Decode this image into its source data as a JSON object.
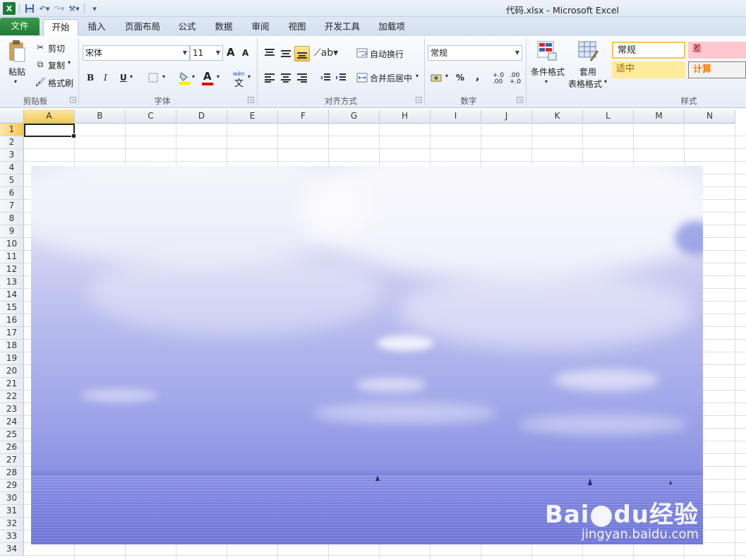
{
  "window": {
    "title": "代码.xlsx  -  Microsoft Excel"
  },
  "tabs": [
    {
      "label": "文件",
      "active": false,
      "file": true
    },
    {
      "label": "开始",
      "active": true
    },
    {
      "label": "插入"
    },
    {
      "label": "页面布局"
    },
    {
      "label": "公式"
    },
    {
      "label": "数据"
    },
    {
      "label": "审阅"
    },
    {
      "label": "视图"
    },
    {
      "label": "开发工具"
    },
    {
      "label": "加载项"
    }
  ],
  "clipboard": {
    "paste": "粘贴",
    "cut": "剪切",
    "copy": "复制",
    "format_painter": "格式刷",
    "group": "剪贴板"
  },
  "font": {
    "name": "宋体",
    "size": "11",
    "group": "字体",
    "bold": "B",
    "italic": "I",
    "underline": "U",
    "grow": "A",
    "shrink": "A",
    "font_color": "A",
    "phonetic": "wén",
    "phonetic_char": "文"
  },
  "alignment": {
    "wrap": "自动换行",
    "merge": "合并后居中",
    "group": "对齐方式"
  },
  "number": {
    "format": "常规",
    "percent": "%",
    "comma": ",",
    "inc": "+.0 .00",
    "dec": ".00 +.0",
    "group": "数字"
  },
  "styles": {
    "conditional": "条件格式",
    "table_line1": "套用",
    "table_line2": "表格格式",
    "normal": "常规",
    "bad": "差",
    "neutral": "适中",
    "calc": "计算",
    "group": "样式"
  },
  "columns": [
    "A",
    "B",
    "C",
    "D",
    "E",
    "F",
    "G",
    "H",
    "I",
    "J",
    "K",
    "L",
    "M",
    "N"
  ],
  "rows": [
    "1",
    "2",
    "3",
    "4",
    "5",
    "6",
    "7",
    "8",
    "9",
    "10",
    "11",
    "12",
    "13",
    "14",
    "15",
    "16",
    "17",
    "18",
    "19",
    "20",
    "21",
    "22",
    "23",
    "24",
    "25",
    "26",
    "27",
    "28",
    "29",
    "30",
    "31",
    "32",
    "33",
    "34"
  ],
  "selection": {
    "column": "A",
    "row": "1"
  },
  "watermark": {
    "logo_a": "Bai",
    "logo_b": "du",
    "logo_c": "经验",
    "url": "jingyan.baidu.com"
  },
  "colors": {
    "file_tab": "#1f7a33",
    "selection": "#f5c853",
    "sky_top": "#eaeaf8",
    "sea": "#6e75d8"
  }
}
